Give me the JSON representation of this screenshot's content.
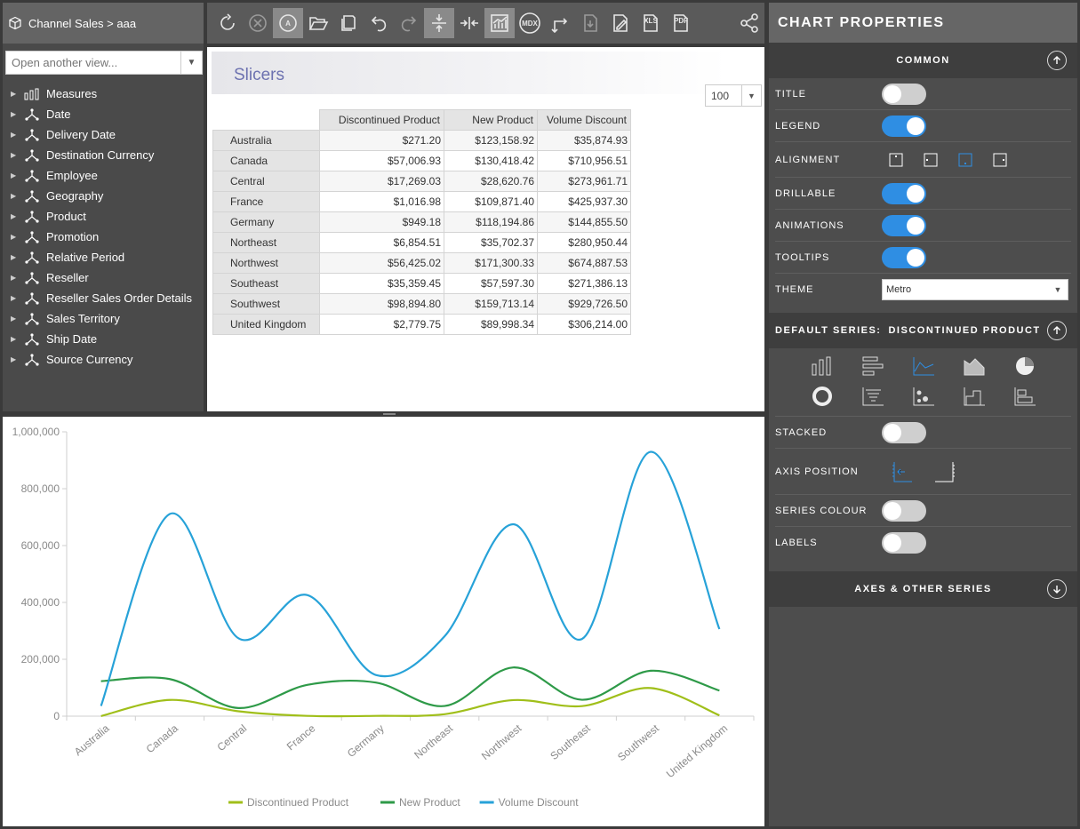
{
  "view": {
    "breadcrumb": "Channel Sales > aaa",
    "open_placeholder": "Open another view..."
  },
  "tree": [
    {
      "label": "Measures",
      "icon": "measures-icon"
    },
    {
      "label": "Date",
      "icon": "hierarchy-icon"
    },
    {
      "label": "Delivery Date",
      "icon": "hierarchy-icon"
    },
    {
      "label": "Destination Currency",
      "icon": "hierarchy-icon"
    },
    {
      "label": "Employee",
      "icon": "hierarchy-icon"
    },
    {
      "label": "Geography",
      "icon": "hierarchy-icon"
    },
    {
      "label": "Product",
      "icon": "hierarchy-icon"
    },
    {
      "label": "Promotion",
      "icon": "hierarchy-icon"
    },
    {
      "label": "Relative Period",
      "icon": "hierarchy-icon"
    },
    {
      "label": "Reseller",
      "icon": "hierarchy-icon"
    },
    {
      "label": "Reseller Sales Order Details",
      "icon": "hierarchy-icon"
    },
    {
      "label": "Sales Territory",
      "icon": "hierarchy-icon"
    },
    {
      "label": "Ship Date",
      "icon": "hierarchy-icon"
    },
    {
      "label": "Source Currency",
      "icon": "hierarchy-icon"
    }
  ],
  "toolbar": {
    "mdx_label": "MDX",
    "xls_label": "XLS",
    "pdf_label": "PDF",
    "auto_label": "A"
  },
  "grid": {
    "slicers_label": "Slicers",
    "page_size": "100",
    "columns": [
      "Discontinued Product",
      "New Product",
      "Volume Discount"
    ],
    "rows": [
      {
        "name": "Australia",
        "values": [
          "$271.20",
          "$123,158.92",
          "$35,874.93"
        ]
      },
      {
        "name": "Canada",
        "values": [
          "$57,006.93",
          "$130,418.42",
          "$710,956.51"
        ]
      },
      {
        "name": "Central",
        "values": [
          "$17,269.03",
          "$28,620.76",
          "$273,961.71"
        ]
      },
      {
        "name": "France",
        "values": [
          "$1,016.98",
          "$109,871.40",
          "$425,937.30"
        ]
      },
      {
        "name": "Germany",
        "values": [
          "$949.18",
          "$118,194.86",
          "$144,855.50"
        ]
      },
      {
        "name": "Northeast",
        "values": [
          "$6,854.51",
          "$35,702.37",
          "$280,950.44"
        ]
      },
      {
        "name": "Northwest",
        "values": [
          "$56,425.02",
          "$171,300.33",
          "$674,887.53"
        ]
      },
      {
        "name": "Southeast",
        "values": [
          "$35,359.45",
          "$57,597.30",
          "$271,386.13"
        ]
      },
      {
        "name": "Southwest",
        "values": [
          "$98,894.80",
          "$159,713.14",
          "$929,726.50"
        ]
      },
      {
        "name": "United Kingdom",
        "values": [
          "$2,779.75",
          "$89,998.34",
          "$306,214.00"
        ]
      }
    ]
  },
  "chart_data": {
    "type": "line",
    "categories": [
      "Australia",
      "Canada",
      "Central",
      "France",
      "Germany",
      "Northeast",
      "Northwest",
      "Southeast",
      "Southwest",
      "United Kingdom"
    ],
    "series": [
      {
        "name": "Discontinued Product",
        "color": "#a0bf1a",
        "values": [
          271.2,
          57006.93,
          17269.03,
          1016.98,
          949.18,
          6854.51,
          56425.02,
          35359.45,
          98894.8,
          2779.75
        ]
      },
      {
        "name": "New Product",
        "color": "#2e9a48",
        "values": [
          123158.92,
          130418.42,
          28620.76,
          109871.4,
          118194.86,
          35702.37,
          171300.33,
          57597.3,
          159713.14,
          89998.34
        ]
      },
      {
        "name": "Volume Discount",
        "color": "#27a2d8",
        "values": [
          35874.93,
          710956.51,
          273961.71,
          425937.3,
          144855.5,
          280950.44,
          674887.53,
          271386.13,
          929726.5,
          306214.0
        ]
      }
    ],
    "ylim": [
      0,
      1000000
    ],
    "yticks": [
      "0",
      "200,000",
      "400,000",
      "600,000",
      "800,000",
      "1,000,000"
    ],
    "legend": "bottom",
    "grid": false
  },
  "props": {
    "title": "CHART PROPERTIES",
    "common_label": "COMMON",
    "rows": {
      "title": {
        "label": "TITLE",
        "on": false
      },
      "legend": {
        "label": "LEGEND",
        "on": true
      },
      "alignment": {
        "label": "ALIGNMENT"
      },
      "drillable": {
        "label": "DRILLABLE",
        "on": true
      },
      "animations": {
        "label": "ANIMATIONS",
        "on": true
      },
      "tooltips": {
        "label": "TOOLTIPS",
        "on": true
      },
      "theme": {
        "label": "THEME",
        "value": "Metro"
      }
    },
    "default_series_label": "DEFAULT SERIES:",
    "default_series_value": "DISCONTINUED PRODUCT",
    "series_rows": {
      "stacked": {
        "label": "STACKED",
        "on": false
      },
      "axis_position": {
        "label": "AXIS POSITION"
      },
      "series_colour": {
        "label": "SERIES COLOUR",
        "on": false
      },
      "labels": {
        "label": "LABELS",
        "on": false
      }
    },
    "axes_label": "AXES & OTHER SERIES"
  }
}
